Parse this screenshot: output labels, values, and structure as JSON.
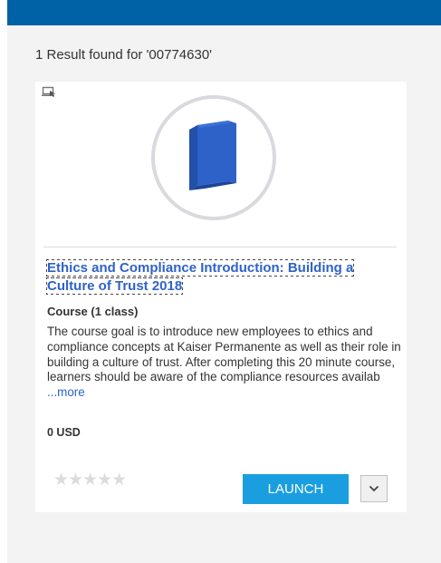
{
  "results": {
    "summary": "1 Result found for '00774630'"
  },
  "card": {
    "title": "Ethics and Compliance Introduction: Building a Culture of Trust 2018",
    "type": "Course (1 class)",
    "description": "The course goal is to introduce new employees to ethics and compliance concepts at Kaiser Permanente as well as their role in building a culture of trust. After completing this 20 minute course, learners should be aware of the compliance resources availab",
    "more_label": "...more",
    "price": "0 USD",
    "rating": {
      "stars_glyph": "★★★★★",
      "value": 0,
      "max": 5
    },
    "launch_label": "LAUNCH",
    "icons": {
      "delivery": "online-delivery-icon",
      "thumbnail": "book-icon",
      "dropdown": "chevron-down-icon"
    }
  },
  "colors": {
    "top_bar": "#0062a6",
    "panel_bg": "#f3f3f3",
    "link": "#2f62c9",
    "launch_bg": "#1a9ee0",
    "book": "#2f62c9"
  }
}
